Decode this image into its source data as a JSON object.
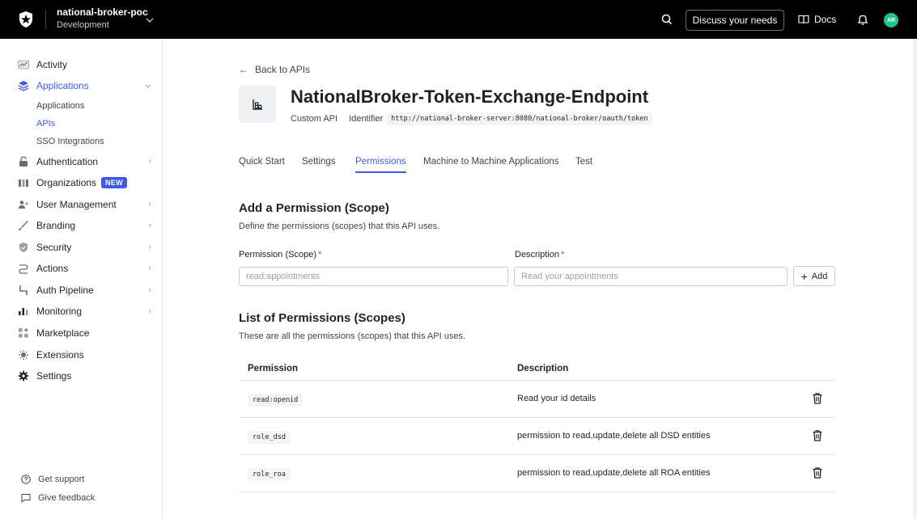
{
  "topbar": {
    "tenant_name": "national-broker-poc",
    "tenant_env": "Development",
    "discuss_label": "Discuss your needs",
    "docs_label": "Docs",
    "avatar_initials": "AR",
    "avatar_color": "#1bc78a"
  },
  "sidebar": {
    "items": [
      {
        "label": "Activity",
        "icon": "activity-icon"
      },
      {
        "label": "Applications",
        "icon": "applications-icon"
      },
      {
        "label": "Authentication",
        "icon": "authentication-icon"
      },
      {
        "label": "Organizations",
        "icon": "organizations-icon",
        "badge": "NEW"
      },
      {
        "label": "User Management",
        "icon": "user-management-icon"
      },
      {
        "label": "Branding",
        "icon": "branding-icon"
      },
      {
        "label": "Security",
        "icon": "security-icon"
      },
      {
        "label": "Actions",
        "icon": "actions-icon"
      },
      {
        "label": "Auth Pipeline",
        "icon": "auth-pipeline-icon"
      },
      {
        "label": "Monitoring",
        "icon": "monitoring-icon"
      },
      {
        "label": "Marketplace",
        "icon": "marketplace-icon"
      },
      {
        "label": "Extensions",
        "icon": "extensions-icon"
      },
      {
        "label": "Settings",
        "icon": "settings-icon"
      }
    ],
    "sub_items": [
      {
        "label": "Applications"
      },
      {
        "label": "APIs"
      },
      {
        "label": "SSO Integrations"
      }
    ],
    "footer": {
      "support": "Get support",
      "feedback": "Give feedback"
    }
  },
  "main": {
    "back_label": "Back to APIs",
    "api_name": "NationalBroker-Token-Exchange-Endpoint",
    "api_type": "Custom API",
    "identifier_label": "Identifier",
    "identifier_value": "http://national-broker-server:8080/national-broker/oauth/token",
    "tabs": [
      {
        "label": "Quick Start"
      },
      {
        "label": "Settings"
      },
      {
        "label": "Permissions"
      },
      {
        "label": "Machine to Machine Applications"
      },
      {
        "label": "Test"
      }
    ],
    "add_section": {
      "title": "Add a Permission (Scope)",
      "subtitle": "Define the permissions (scopes) that this API uses.",
      "permission_label": "Permission (Scope)",
      "permission_placeholder": "read:appointments",
      "description_label": "Description",
      "description_placeholder": "Read your appointments",
      "required_mark": "*",
      "add_label": "Add"
    },
    "list_section": {
      "title": "List of Permissions (Scopes)",
      "subtitle": "These are all the permissions (scopes) that this API uses.",
      "columns": [
        "Permission",
        "Description"
      ],
      "rows": [
        {
          "permission": "read:openid",
          "description": "Read your id details"
        },
        {
          "permission": "role_dsd",
          "description": "permission to read,update,delete all DSD entities"
        },
        {
          "permission": "role_roa",
          "description": "permission to read,update,delete all ROA entities"
        }
      ]
    }
  },
  "colors": {
    "accent": "#3f59e4",
    "topbar": "#000000",
    "required": "#d03c38"
  }
}
